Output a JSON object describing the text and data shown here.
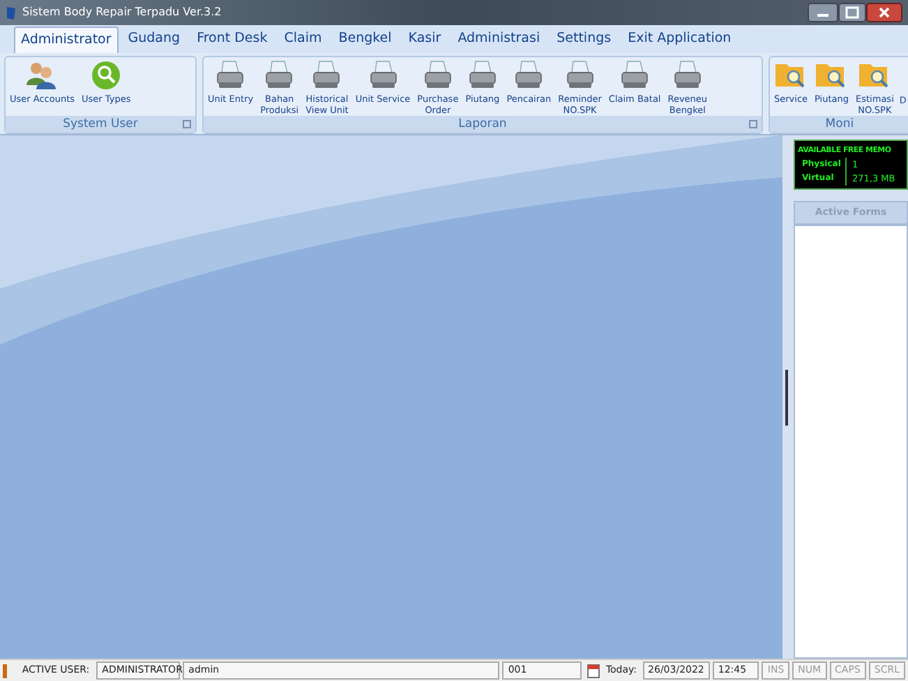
{
  "window": {
    "title": "Sistem Body Repair Terpadu Ver.3.2"
  },
  "tabs": [
    {
      "label": "Administrator",
      "selected": true
    },
    {
      "label": "Gudang",
      "selected": false
    },
    {
      "label": "Front Desk",
      "selected": false
    },
    {
      "label": "Claim",
      "selected": false
    },
    {
      "label": "Bengkel",
      "selected": false
    },
    {
      "label": "Kasir",
      "selected": false
    },
    {
      "label": "Administrasi",
      "selected": false
    },
    {
      "label": "Settings",
      "selected": false
    },
    {
      "label": "Exit Application",
      "selected": false
    }
  ],
  "ribbon_groups": [
    {
      "label": "System User",
      "launcher": true,
      "items": [
        {
          "label": "User Accounts",
          "kind": "users"
        },
        {
          "label": "User Types",
          "kind": "search"
        }
      ]
    },
    {
      "label": "Laporan",
      "launcher": true,
      "items": [
        {
          "label": "Unit Entry",
          "kind": "printer"
        },
        {
          "label": "Bahan\nProduksi",
          "kind": "printer"
        },
        {
          "label": "Historical\nView Unit",
          "kind": "printer"
        },
        {
          "label": "Unit Service",
          "kind": "printer"
        },
        {
          "label": "Purchase\nOrder",
          "kind": "printer"
        },
        {
          "label": "Piutang",
          "kind": "printer"
        },
        {
          "label": "Pencairan",
          "kind": "printer"
        },
        {
          "label": "Reminder\nNO.SPK",
          "kind": "printer"
        },
        {
          "label": "Claim Batal",
          "kind": "printer"
        },
        {
          "label": "Reveneu\nBengkel",
          "kind": "printer"
        }
      ]
    },
    {
      "label": "Moni",
      "launcher": false,
      "items": [
        {
          "label": "Service",
          "kind": "folder"
        },
        {
          "label": "Piutang",
          "kind": "folder"
        },
        {
          "label": "Estimasi\nNO.SPK",
          "kind": "folder"
        },
        {
          "label": "D",
          "kind": "text"
        }
      ]
    }
  ],
  "memory": {
    "title": "AVAILABLE FREE MEMO",
    "rows": [
      {
        "label": "Physical",
        "value": "1"
      },
      {
        "label": "Virtual",
        "value": "271,3 MB"
      }
    ]
  },
  "active_forms": {
    "title": "Active Forms"
  },
  "status_bar": {
    "user_label": "ACTIVE USER:",
    "role": "ADMINISTRATOR",
    "user": "admin",
    "code": "001",
    "today_label": "Today:",
    "date": "26/03/2022",
    "time": "12:45",
    "keys": [
      "INS",
      "NUM",
      "CAPS",
      "SCRL"
    ]
  }
}
